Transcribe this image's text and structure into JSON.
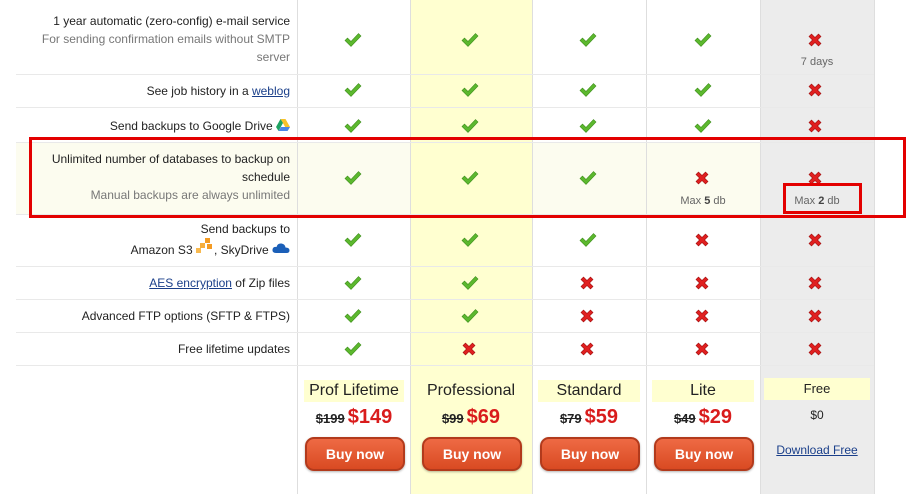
{
  "features": [
    {
      "lines": [
        "1 year automatic (zero-config) e-mail service"
      ],
      "sub": [
        "For sending confirmation emails without SMTP",
        "server"
      ],
      "values": [
        "check",
        "check",
        "check",
        "check",
        "cross"
      ],
      "free_note": "7 days"
    },
    {
      "prefix": "See job history in a ",
      "link": "weblog",
      "values": [
        "check",
        "check",
        "check",
        "check",
        "cross"
      ]
    },
    {
      "text": "Send backups to Google Drive",
      "icon": "google-drive-icon",
      "values": [
        "check",
        "check",
        "check",
        "check",
        "cross"
      ]
    },
    {
      "lines": [
        "Unlimited number of databases to backup on",
        "schedule"
      ],
      "sub": [
        "Manual backups are always unlimited"
      ],
      "values": [
        "check",
        "check",
        "check",
        "cross",
        "cross"
      ],
      "lite_note": {
        "prefix": "Max ",
        "num": "5",
        "suffix": " db"
      },
      "free_note": {
        "prefix": "Max ",
        "num": "2",
        "suffix": " db"
      }
    },
    {
      "line1": "Send backups to",
      "line2a": "Amazon S3",
      "line2b": ", SkyDrive",
      "icons": [
        "amazon-s3-icon",
        "skydrive-icon"
      ],
      "values": [
        "check",
        "check",
        "check",
        "cross",
        "cross"
      ]
    },
    {
      "link": "AES encryption",
      "suffix": " of Zip files",
      "values": [
        "check",
        "check",
        "cross",
        "cross",
        "cross"
      ]
    },
    {
      "text": "Advanced FTP options (SFTP & FTPS)",
      "values": [
        "check",
        "check",
        "cross",
        "cross",
        "cross"
      ]
    },
    {
      "text": "Free lifetime updates",
      "values": [
        "check",
        "cross",
        "cross",
        "cross",
        "cross"
      ]
    }
  ],
  "plans": [
    {
      "name": "Prof Lifetime",
      "old_price": "$199",
      "new_price": "$149",
      "button": "Buy now"
    },
    {
      "name": "Professional",
      "old_price": "$99",
      "new_price": "$69",
      "button": "Buy now"
    },
    {
      "name": "Standard",
      "old_price": "$79",
      "new_price": "$59",
      "button": "Buy now"
    },
    {
      "name": "Lite",
      "old_price": "$49",
      "new_price": "$29",
      "button": "Buy now"
    },
    {
      "name": "Free",
      "price": "$0",
      "link": "Download Free"
    }
  ],
  "colors": {
    "check": "#5cb82e",
    "cross": "#e02020",
    "highlight": "#e30000",
    "price_red": "#d91c1c",
    "button": "#de5430",
    "professional_bg": "#ffffd0",
    "free_bg": "#ececec"
  }
}
